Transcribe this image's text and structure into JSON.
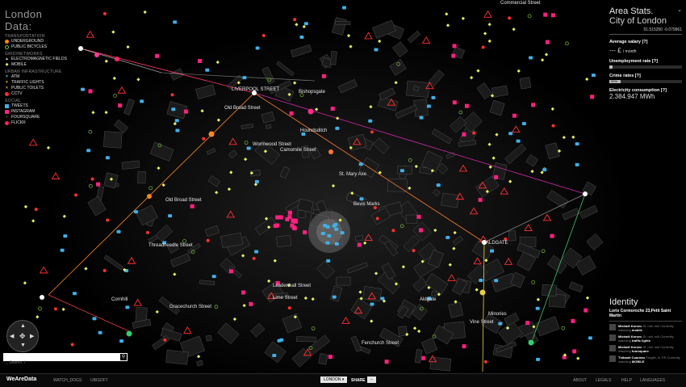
{
  "legend": {
    "title": "London Data:",
    "groups": [
      {
        "name": "TRANSPORTATION",
        "items": [
          {
            "label": "UNDERGROUND",
            "icon": "underground-circle-icon",
            "color": "#ff8800"
          },
          {
            "label": "PUBLIC BICYCLES",
            "icon": "bicycle-circle-icon",
            "color": "#7fbf3f"
          }
        ]
      },
      {
        "name": "GRID/NETWORKS",
        "items": [
          {
            "label": "ELECTROMAGNETIC FIELDS",
            "icon": "triangle-icon",
            "color": "#cccccc"
          },
          {
            "label": "MOBILE",
            "icon": "diamond-icon",
            "color": "#e8f060"
          }
        ]
      },
      {
        "name": "URBAN INFRASTRUCTURE",
        "items": [
          {
            "label": "ATM",
            "icon": "atm-triangle-icon",
            "color": "#2fa8b8"
          },
          {
            "label": "TRAFFIC LIGHTS",
            "icon": "traffic-light-icon",
            "color": "#e8c040"
          },
          {
            "label": "PUBLIC TOILETS",
            "icon": "toilet-cross-icon",
            "color": "#e8c040"
          },
          {
            "label": "CCTV",
            "icon": "cctv-circle-icon",
            "color": "#ff3030"
          }
        ]
      },
      {
        "name": "SOCIAL",
        "items": [
          {
            "label": "TWEETS",
            "icon": "twitter-bird-icon",
            "color": "#3fb0e8"
          },
          {
            "label": "INSTAGRAM",
            "icon": "instagram-icon",
            "color": "#ff2080"
          },
          {
            "label": "FOURSQUARE",
            "icon": "foursquare-icon",
            "color": "#7fbf3f"
          },
          {
            "label": "FLICKR",
            "icon": "flickr-icon",
            "color": "#ff2060"
          }
        ]
      }
    ]
  },
  "streets": [
    {
      "label": "Commercial Street"
    },
    {
      "label": "LIVERPOOL STREET"
    },
    {
      "label": "Bishopsgate"
    },
    {
      "label": "Old Broad Street"
    },
    {
      "label": "Houndsditch"
    },
    {
      "label": "Wormwood Street"
    },
    {
      "label": "Camomile Street"
    },
    {
      "label": "St. Mary Axe"
    },
    {
      "label": "Old Broad Street"
    },
    {
      "label": "Bevis Marks"
    },
    {
      "label": "Threadneedle Street"
    },
    {
      "label": "ALDGATE"
    },
    {
      "label": "Leadenhall Street"
    },
    {
      "label": "Lime Street"
    },
    {
      "label": "Aldgate"
    },
    {
      "label": "Cornhill"
    },
    {
      "label": "Gracechurch Street"
    },
    {
      "label": "Minories"
    },
    {
      "label": "Vine Street"
    },
    {
      "label": "Fenchurch Street"
    }
  ],
  "stats": {
    "title": "Area Stats.",
    "area": "City of London",
    "coords": "51.515250  -0.079961",
    "salary_label": "Average salary [?]",
    "salary_value": "--- £",
    "salary_unit": "/ month",
    "unemployment_label": "Unemployment rate [?]",
    "unemployment_fill": 0.04,
    "crime_label": "Crime rates [?]",
    "crime_value": "99%",
    "crime_fill": 0.16,
    "electricity_label": "Electricity consumption [?]",
    "electricity_value": "2.384.947 MWh"
  },
  "identity": {
    "title": "Identity",
    "place": "Loris Cormoroche 23,Petit Saint Martin",
    "entries": [
      {
        "name": "Michaël Korsec",
        "text": "St. null, null Currently watching",
        "target": "mobile"
      },
      {
        "name": "Michaël Korsec",
        "text": "St. null, null Currently watching",
        "target": "traffic lights"
      },
      {
        "name": "Michaël Korsec",
        "text": "St. null, null Currently watching",
        "target": "foursquare"
      },
      {
        "name": "Thibault Cuarnau",
        "text": "Fitzgilh, N, FR Currently watching",
        "target": "MOBILE"
      }
    ]
  },
  "search": {
    "placeholder": "_ Search  /"
  },
  "footer": {
    "logo": "WeAreData",
    "links": [
      "WATCH_DOGS",
      "UBISOFT"
    ],
    "city": "LONDON ▾",
    "share": "SHARE",
    "right": [
      "ABOUT",
      "LEGALS",
      "HELP",
      "LANGUAGES"
    ]
  },
  "colors": {
    "tweet": "#3fb0e8",
    "mobile": "#e8f060",
    "cctv": "#ff3030",
    "instagram": "#ff2080",
    "bicycle": "#4fd070",
    "underground": "#ff8800"
  }
}
